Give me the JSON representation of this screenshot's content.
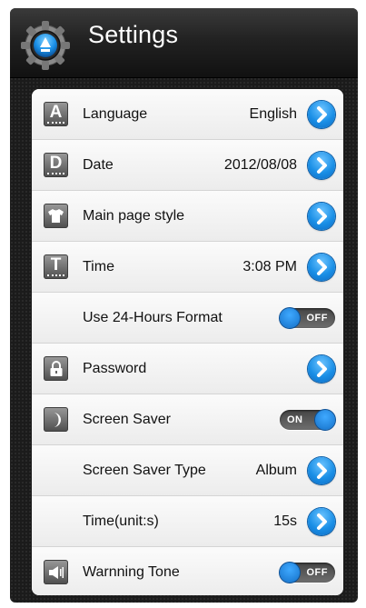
{
  "header": {
    "title": "Settings",
    "icon": "gear-icon"
  },
  "colors": {
    "accent": "#1a8fe6",
    "background": "#1b1b1b",
    "panel": "#f4f4f4"
  },
  "rows": [
    {
      "id": "language",
      "label": "Language",
      "value": "English",
      "icon": "letter-a-icon",
      "icon_glyph": "A",
      "control": "arrow"
    },
    {
      "id": "date",
      "label": "Date",
      "value": "2012/08/08",
      "icon": "letter-d-icon",
      "icon_glyph": "D",
      "control": "arrow"
    },
    {
      "id": "main-page-style",
      "label": "Main page style",
      "value": "",
      "icon": "shirt-icon",
      "control": "arrow"
    },
    {
      "id": "time",
      "label": "Time",
      "value": "3:08 PM",
      "icon": "letter-t-icon",
      "icon_glyph": "T",
      "control": "arrow"
    },
    {
      "id": "24h-format",
      "label": "Use 24-Hours Format",
      "value": "",
      "icon": "",
      "control": "toggle",
      "state": "OFF"
    },
    {
      "id": "password",
      "label": "Password",
      "value": "",
      "icon": "lock-icon",
      "control": "arrow"
    },
    {
      "id": "screen-saver",
      "label": "Screen Saver",
      "value": "",
      "icon": "moon-icon",
      "control": "toggle",
      "state": "ON"
    },
    {
      "id": "screen-saver-type",
      "label": "Screen Saver Type",
      "value": "Album",
      "icon": "",
      "control": "arrow"
    },
    {
      "id": "time-unit",
      "label": "Time(unit:s)",
      "value": "15s",
      "icon": "",
      "control": "arrow"
    },
    {
      "id": "warning-tone",
      "label": "Warnning Tone",
      "value": "",
      "icon": "speaker-icon",
      "control": "toggle",
      "state": "OFF"
    }
  ]
}
